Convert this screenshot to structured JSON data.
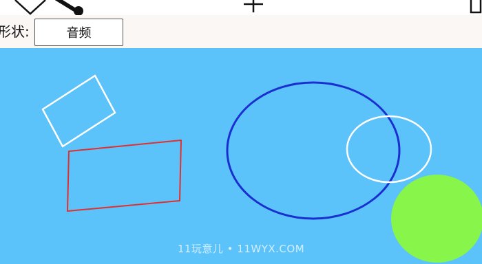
{
  "toolbar": {
    "tools": [
      {
        "icon": "pen-tool-icon"
      },
      {
        "icon": "paint-brush-icon"
      },
      {
        "icon": "plus-icon"
      },
      {
        "icon": "window-icon"
      }
    ]
  },
  "shape_selector": {
    "label": "形状:",
    "value": "音频"
  },
  "canvas": {
    "background_color": "#5bc2fa",
    "shapes": [
      {
        "kind": "rectangle",
        "stroke": "#ffffff"
      },
      {
        "kind": "rectangle",
        "stroke": "#e03030"
      },
      {
        "kind": "ellipse",
        "stroke": "#1a2fd0"
      },
      {
        "kind": "ellipse",
        "stroke": "#ffffff"
      },
      {
        "kind": "ellipse-filled",
        "fill": "#88f54a"
      }
    ]
  },
  "watermark": "11玩意儿 • 11WYX.COM"
}
